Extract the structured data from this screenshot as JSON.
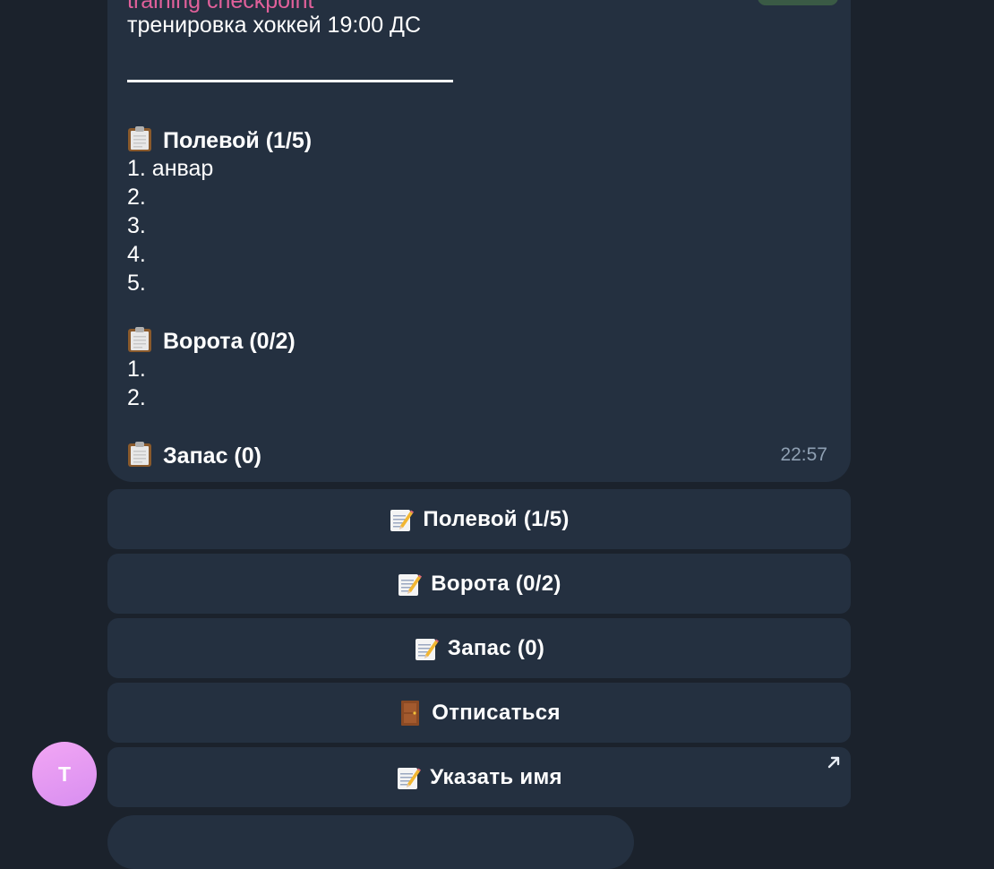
{
  "message": {
    "sender": "training checkpoint",
    "lines": [
      {
        "text": "тренировка хоккей 19:00 ДС",
        "bold": false
      },
      {
        "text": "",
        "bold": false
      },
      {
        "text": "",
        "bold": false
      },
      {
        "text": "",
        "bold": false
      },
      {
        "text": "Полевой (1/5)",
        "bold": true,
        "icon": "clipboard-icon"
      },
      {
        "text": "1. анвар",
        "bold": false
      },
      {
        "text": "2.",
        "bold": false
      },
      {
        "text": "3.",
        "bold": false
      },
      {
        "text": "4.",
        "bold": false
      },
      {
        "text": "5.",
        "bold": false
      },
      {
        "text": "",
        "bold": false
      },
      {
        "text": "Ворота (0/2)",
        "bold": true,
        "icon": "clipboard-icon"
      },
      {
        "text": "1.",
        "bold": false
      },
      {
        "text": "2.",
        "bold": false
      },
      {
        "text": "",
        "bold": false
      },
      {
        "text": "Запас (0)",
        "bold": true,
        "icon": "clipboard-icon"
      }
    ],
    "time": "22:57"
  },
  "buttons": [
    {
      "label": "Полевой (1/5)",
      "icon": "memo-icon"
    },
    {
      "label": "Ворота (0/2)",
      "icon": "memo-icon"
    },
    {
      "label": "Запас (0)",
      "icon": "memo-icon"
    },
    {
      "label": "Отписаться",
      "icon": "door-icon"
    },
    {
      "label": "Указать имя",
      "icon": "memo-icon",
      "link": true
    }
  ],
  "avatar": {
    "letter": "T",
    "color": "#e7a0f2"
  },
  "colors": {
    "background": "#1b222c",
    "bubble": "#243040",
    "sender": "#e0609a",
    "time": "#8fa0b3"
  }
}
